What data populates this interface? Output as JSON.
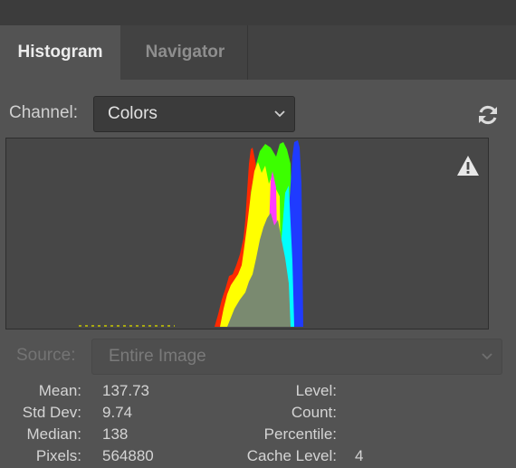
{
  "tabs": [
    {
      "label": "Histogram",
      "active": true
    },
    {
      "label": "Navigator",
      "active": false
    }
  ],
  "channel": {
    "label": "Channel:",
    "value": "Colors"
  },
  "source": {
    "label": "Source:",
    "value": "Entire Image",
    "disabled": true
  },
  "icons": {
    "refresh": "refresh-icon",
    "warning": "warning-icon",
    "dropdown": "chevron-down-icon"
  },
  "stats": {
    "mean": {
      "label": "Mean:",
      "value": "137.73"
    },
    "std_dev": {
      "label": "Std Dev:",
      "value": "9.74"
    },
    "median": {
      "label": "Median:",
      "value": "138"
    },
    "pixels": {
      "label": "Pixels:",
      "value": "564880"
    },
    "level": {
      "label": "Level:",
      "value": ""
    },
    "count": {
      "label": "Count:",
      "value": ""
    },
    "percentile": {
      "label": "Percentile:",
      "value": ""
    },
    "cache_level": {
      "label": "Cache Level:",
      "value": "4"
    }
  },
  "colors": {
    "panel_bg": "#535353",
    "tab_strip": "#424242",
    "histogram_bg": "#474747",
    "red": "#ff2a00",
    "green": "#3cff00",
    "blue": "#1f3bff",
    "yellow": "#ffff00",
    "cyan": "#00ffff",
    "magenta": "#ff3cff",
    "gray": "#7a8a70"
  }
}
